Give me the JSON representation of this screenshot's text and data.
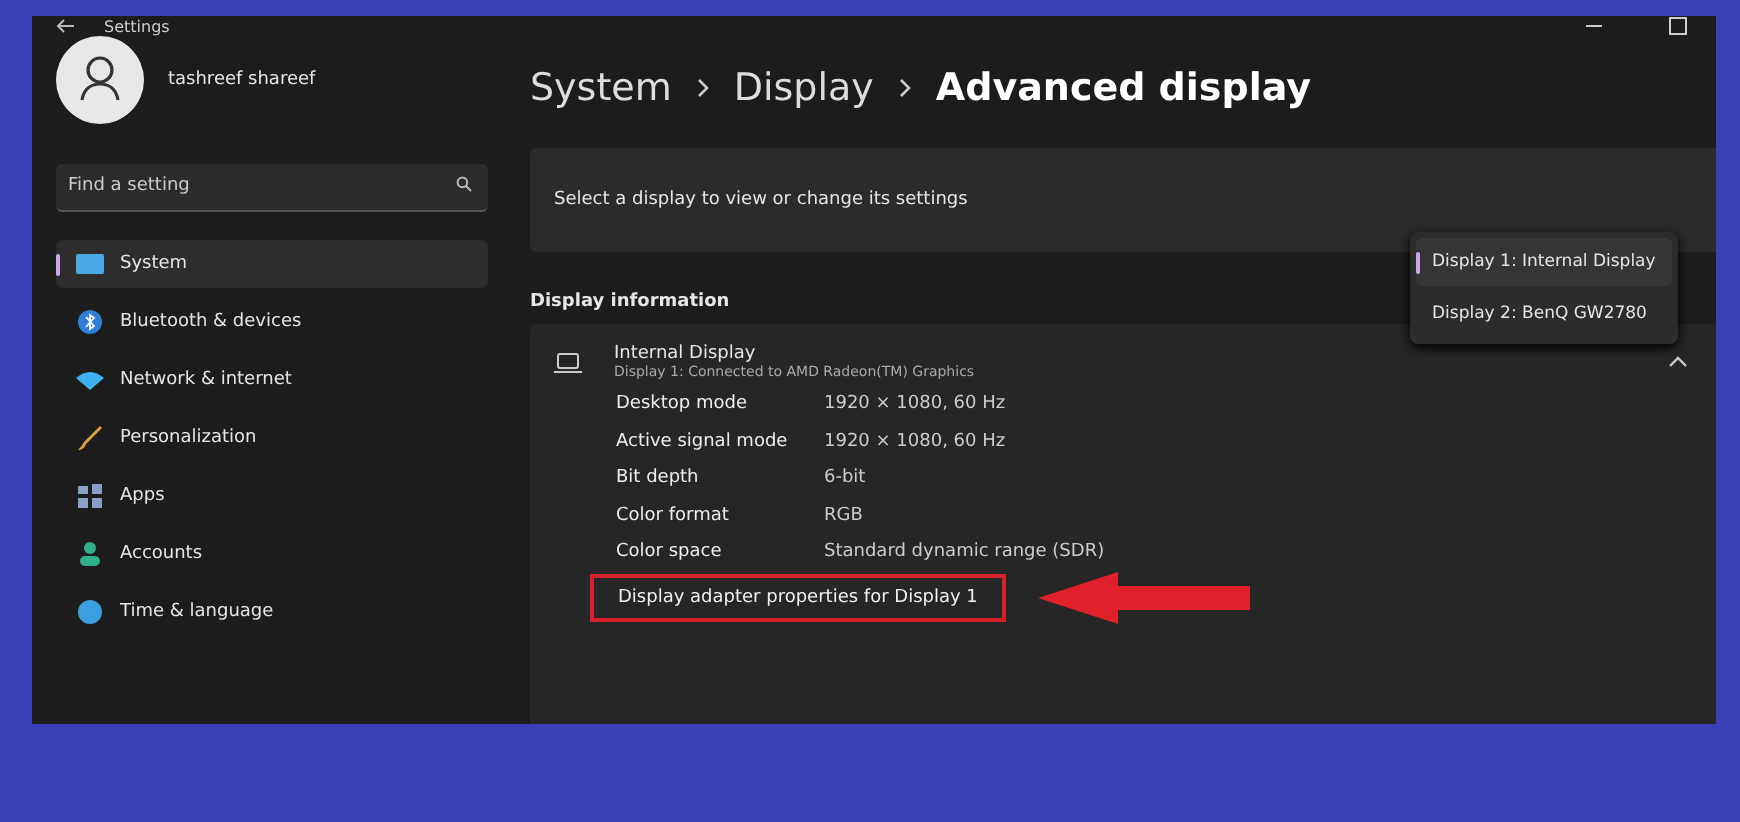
{
  "window": {
    "title": "Settings"
  },
  "user": {
    "name": "tashreef shareef"
  },
  "search": {
    "placeholder": "Find a setting"
  },
  "sidebar": {
    "items": [
      {
        "label": "System",
        "selected": true
      },
      {
        "label": "Bluetooth & devices",
        "selected": false
      },
      {
        "label": "Network & internet",
        "selected": false
      },
      {
        "label": "Personalization",
        "selected": false
      },
      {
        "label": "Apps",
        "selected": false
      },
      {
        "label": "Accounts",
        "selected": false
      },
      {
        "label": "Time & language",
        "selected": false
      }
    ]
  },
  "breadcrumb": [
    "System",
    "Display",
    "Advanced display"
  ],
  "select_display": {
    "label": "Select a display to view or change its settings",
    "options": [
      {
        "label": "Display 1: Internal Display",
        "selected": true
      },
      {
        "label": "Display 2: BenQ GW2780",
        "selected": false
      }
    ]
  },
  "display_information": {
    "heading": "Display information",
    "name": "Internal Display",
    "subtitle": "Display 1: Connected to AMD Radeon(TM) Graphics",
    "expanded": true,
    "rows": [
      {
        "label": "Desktop mode",
        "value": "1920 × 1080, 60 Hz"
      },
      {
        "label": "Active signal mode",
        "value": "1920 × 1080, 60 Hz"
      },
      {
        "label": "Bit depth",
        "value": "6-bit"
      },
      {
        "label": "Color format",
        "value": "RGB"
      },
      {
        "label": "Color space",
        "value": "Standard dynamic range (SDR)"
      }
    ],
    "link": {
      "label": "Display adapter properties for Display 1",
      "highlighted": true
    }
  }
}
